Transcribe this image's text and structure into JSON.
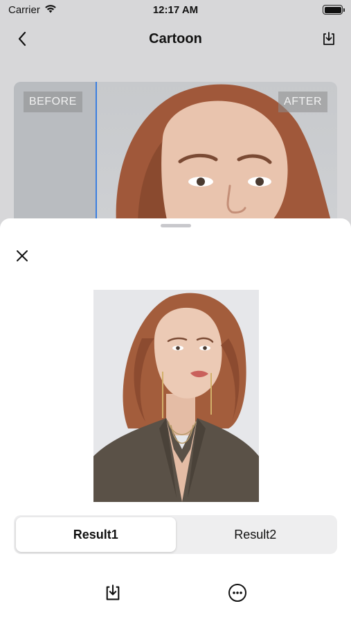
{
  "status_bar": {
    "carrier": "Carrier",
    "time": "12:17 AM",
    "icons": [
      "wifi-icon",
      "battery-icon"
    ]
  },
  "nav": {
    "title": "Cartoon",
    "back_icon": "chevron-left-icon",
    "save_icon": "download-icon"
  },
  "compare": {
    "before_label": "BEFORE",
    "after_label": "AFTER",
    "divider_color": "#3b7fe0"
  },
  "sheet": {
    "close_icon": "close-icon",
    "segments": [
      {
        "label": "Result1",
        "selected": true
      },
      {
        "label": "Result2",
        "selected": false
      }
    ],
    "actions": [
      {
        "icon": "download-icon"
      },
      {
        "icon": "more-circle-icon"
      }
    ]
  }
}
